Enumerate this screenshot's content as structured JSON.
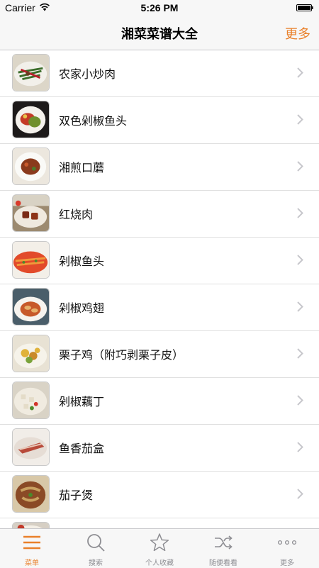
{
  "status_bar": {
    "carrier": "Carrier",
    "time": "5:26 PM"
  },
  "nav": {
    "title": "湘菜菜谱大全",
    "more": "更多"
  },
  "recipes": [
    {
      "name": "农家小炒肉"
    },
    {
      "name": "双色剁椒鱼头"
    },
    {
      "name": "湘煎口蘑"
    },
    {
      "name": "红烧肉"
    },
    {
      "name": "剁椒鱼头"
    },
    {
      "name": "剁椒鸡翅"
    },
    {
      "name": "栗子鸡（附巧剥栗子皮）"
    },
    {
      "name": "剁椒藕丁"
    },
    {
      "name": "鱼香茄盒"
    },
    {
      "name": "茄子煲"
    }
  ],
  "tabs": [
    {
      "label": "菜单",
      "icon": "menu-icon",
      "active": true
    },
    {
      "label": "搜索",
      "icon": "search-icon",
      "active": false
    },
    {
      "label": "个人收藏",
      "icon": "star-icon",
      "active": false
    },
    {
      "label": "随便看看",
      "icon": "shuffle-icon",
      "active": false
    },
    {
      "label": "更多",
      "icon": "more-icon",
      "active": false
    }
  ],
  "colors": {
    "accent": "#e9802a",
    "inactive": "#8e8e93"
  }
}
